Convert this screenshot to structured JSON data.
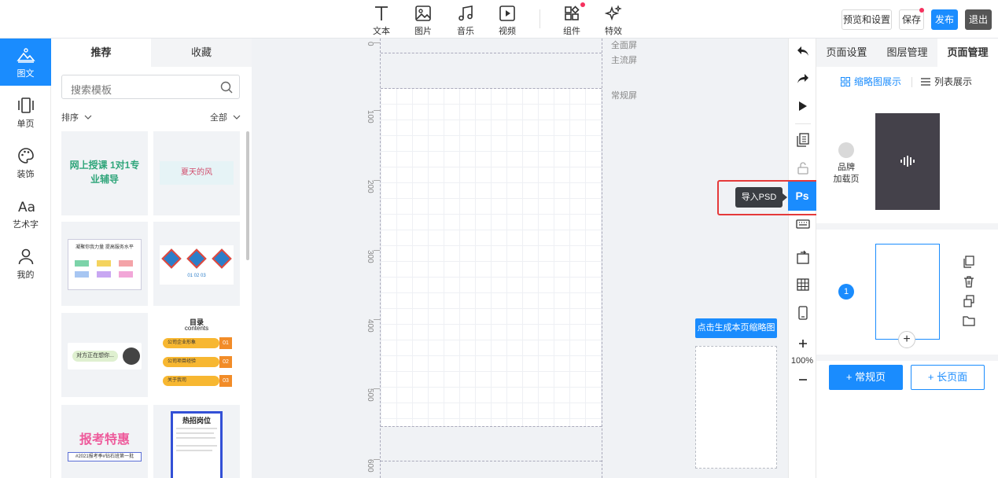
{
  "toolbar": {
    "tools": [
      {
        "label": "文本",
        "icon": "text-icon"
      },
      {
        "label": "图片",
        "icon": "image-icon"
      },
      {
        "label": "音乐",
        "icon": "music-icon"
      },
      {
        "label": "视频",
        "icon": "video-icon"
      },
      {
        "label": "组件",
        "icon": "components-icon"
      },
      {
        "label": "特效",
        "icon": "effects-icon"
      }
    ],
    "preview_label": "预览和设置",
    "save_label": "保存",
    "publish_label": "发布",
    "exit_label": "退出"
  },
  "leftnav": {
    "items": [
      {
        "label": "图文",
        "icon": "landscape-icon",
        "active": true
      },
      {
        "label": "单页",
        "icon": "pages-icon"
      },
      {
        "label": "装饰",
        "icon": "palette-icon"
      },
      {
        "label": "艺术字",
        "icon": "font-icon"
      },
      {
        "label": "我的",
        "icon": "user-icon"
      }
    ]
  },
  "templates": {
    "tabs": [
      "推荐",
      "收藏"
    ],
    "search_placeholder": "搜索模板",
    "sort_label": "排序",
    "filter_label": "全部",
    "cards": [
      {
        "text": "网上授课 1对1专业辅导"
      },
      {
        "text": "夏天的风"
      },
      {
        "text": "凝聚你我力量 提高服务水平"
      },
      {
        "text": "01 02 03"
      },
      {
        "text": "对方正在想你..."
      },
      {
        "title": "目录",
        "subtitle": "contents",
        "items": [
          "公司企业形象",
          "公司项目经验",
          "关于我司"
        ],
        "nums": [
          "01",
          "02",
          "03"
        ]
      },
      {
        "text": "报考特惠",
        "sub": "#2021报考季#钻石班第一批"
      },
      {
        "text": "热招岗位"
      }
    ]
  },
  "canvas": {
    "ruler_labels": [
      "0",
      "100",
      "200",
      "300",
      "400",
      "500",
      "600"
    ],
    "screen_labels": [
      "全面屏",
      "主流屏",
      "常规屏"
    ],
    "generate_thumbnail_label": "点击生成本页缩略图"
  },
  "vtoolbar": {
    "ps_label": "Ps",
    "tooltip": "导入PSD",
    "zoom": "100%"
  },
  "rightpanel": {
    "tabs": [
      "页面设置",
      "图层管理",
      "页面管理"
    ],
    "view_modes": [
      "缩略图展示",
      "列表展示"
    ],
    "brand_label_1": "品牌",
    "brand_label_2": "加载页",
    "page_number": "1",
    "add_normal_page": "+ 常规页",
    "add_long_page": "+ 长页面"
  },
  "colors": {
    "accent": "#1a8cfe",
    "highlight": "#e53a3a"
  }
}
